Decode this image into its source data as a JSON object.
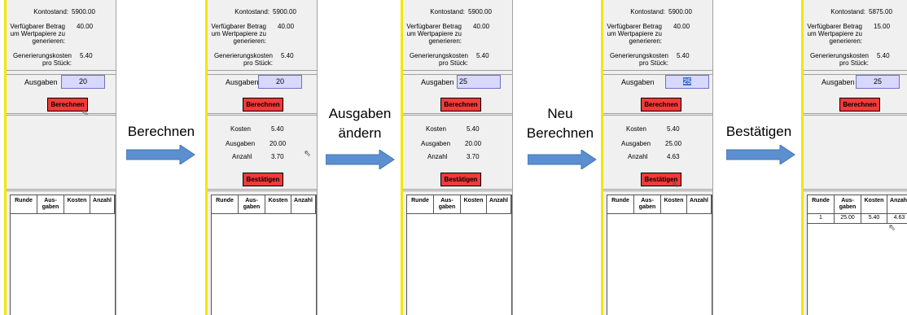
{
  "labels": {
    "kontostand": "Kontostand:",
    "betrag": "Verfügbarer Betrag um Wertpapiere zu generieren:",
    "genkosten": "Generierungskosten pro Stück:",
    "ausgaben": "Ausgaben",
    "berechnen": "Berechnen",
    "bestaetigen": "Bestätigen",
    "kosten": "Kosten",
    "ausgaben_res": "Ausgaben",
    "anzahl": "Anzahl"
  },
  "table_headers": [
    "Runde",
    "Aus-gaben",
    "Kosten",
    "Anzahl"
  ],
  "steps": [
    {
      "kontostand": "5900.00",
      "betrag": "40.00",
      "genkosten": "5.40",
      "ausgaben": "20"
    },
    {
      "kontostand": "5900.00",
      "betrag": "40.00",
      "genkosten": "5.40",
      "ausgaben": "20",
      "res_kosten": "5.40",
      "res_ausgaben": "20.00",
      "res_anzahl": "3.70"
    },
    {
      "kontostand": "5900.00",
      "betrag": "40.00",
      "genkosten": "5.40",
      "ausgaben": "25",
      "res_kosten": "5.40",
      "res_ausgaben": "20.00",
      "res_anzahl": "3.70"
    },
    {
      "kontostand": "5900.00",
      "betrag": "40.00",
      "genkosten": "5.40",
      "ausgaben": "25",
      "res_kosten": "5.40",
      "res_ausgaben": "25.00",
      "res_anzahl": "4.63"
    },
    {
      "kontostand": "5875.00",
      "betrag": "15.00",
      "genkosten": "5.40",
      "ausgaben": "25",
      "row": [
        "1",
        "25.00",
        "5.40",
        "4.63"
      ]
    }
  ],
  "transitions": [
    "Berechnen",
    "Ausgaben ändern",
    "Neu Berechnen",
    "Bestätigen"
  ],
  "colors": {
    "button": "#f23a3a",
    "field": "#d8d8ff",
    "arrow": "#5b8fcf",
    "panel_border": "#f3e600"
  }
}
